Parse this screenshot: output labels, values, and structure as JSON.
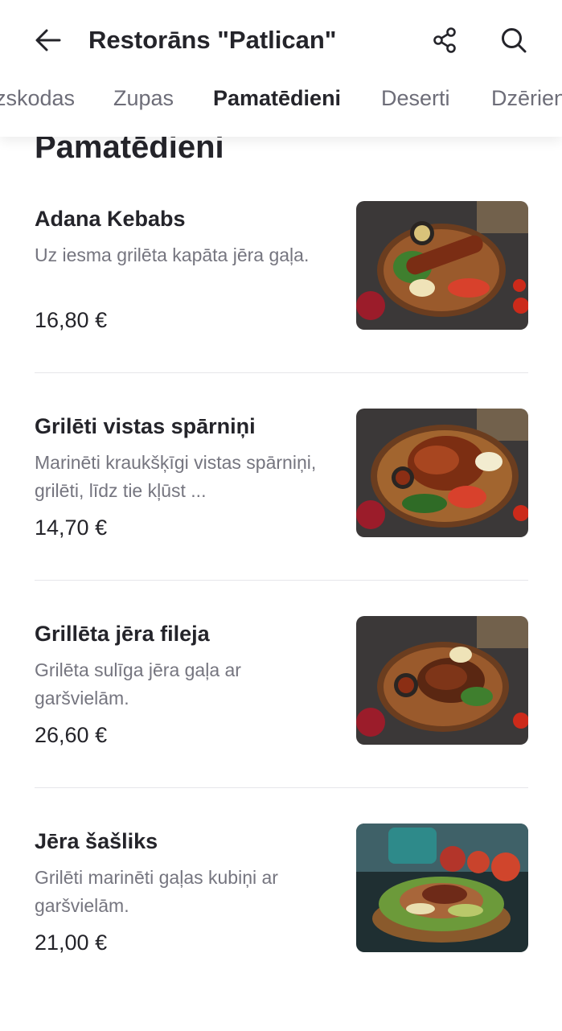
{
  "header": {
    "title": "Restorāns \"Patlican\"",
    "back_icon": "arrow-left-icon",
    "share_icon": "share-icon",
    "search_icon": "search-icon"
  },
  "tabs": [
    {
      "label": "zskodas",
      "active": false
    },
    {
      "label": "Zupas",
      "active": false
    },
    {
      "label": "Pamatēdieni",
      "active": true
    },
    {
      "label": "Deserti",
      "active": false
    },
    {
      "label": "Dzērien",
      "active": false
    }
  ],
  "section": {
    "title": "Pamatēdieni"
  },
  "items": [
    {
      "name": "Adana Kebabs",
      "description": "Uz iesma grilēta kapāta jēra gaļa.",
      "price": "16,80 €"
    },
    {
      "name": "Grilēti vistas spārniņi",
      "description": "Marinēti kraukšķīgi vistas spārniņi, grilēti, līdz tie kļūst ...",
      "price": "14,70 €"
    },
    {
      "name": "Grillēta jēra fileja",
      "description": "Grilēta sulīga jēra gaļa ar garšvielām.",
      "price": "26,60 €"
    },
    {
      "name": "Jēra šašliks",
      "description": "Grilēti marinēti gaļas kubiņi ar garšvielām.",
      "price": "21,00 €"
    }
  ],
  "colors": {
    "text_primary": "#24242a",
    "text_secondary": "#75757f",
    "divider": "#e6e6ea",
    "background": "#ffffff"
  }
}
